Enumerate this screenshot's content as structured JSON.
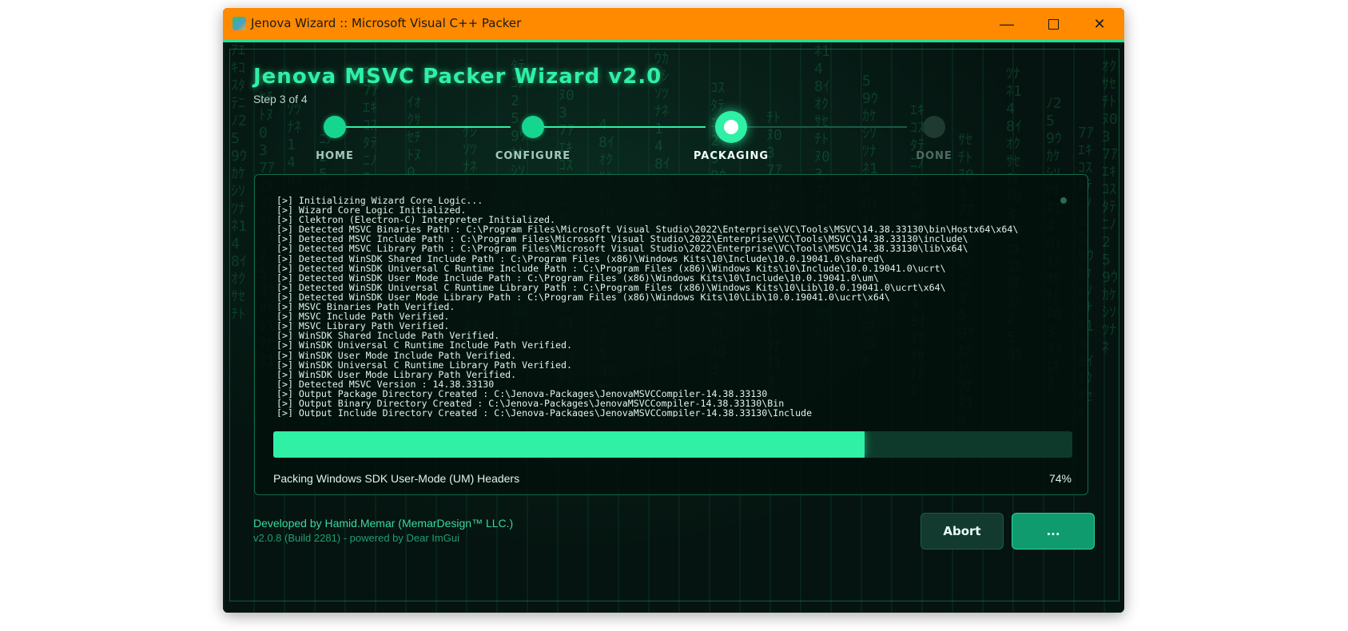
{
  "window": {
    "title": "Jenova Wizard :: Microsoft Visual C++ Packer",
    "title_bar_color": "#ff8a00",
    "controls": {
      "minimize_icon": "—",
      "close_icon": "✕"
    }
  },
  "wizard": {
    "title": "Jenova MSVC Packer Wizard v2.0",
    "step_text": "Step 3 of 4",
    "steps": [
      {
        "label": "HOME",
        "state": "done"
      },
      {
        "label": "CONFIGURE",
        "state": "done"
      },
      {
        "label": "PACKAGING",
        "state": "active"
      },
      {
        "label": "DONE",
        "state": "pending"
      }
    ],
    "accent_color": "#2ff0a5"
  },
  "log": {
    "lines": [
      "[>] Initializing Wizard Core Logic...",
      "[>] Wizard Core Logic Initialized.",
      "[>] Clektron (Electron-C) Interpreter Initialized.",
      "[>] Detected MSVC Binaries Path : C:\\Program Files\\Microsoft Visual Studio\\2022\\Enterprise\\VC\\Tools\\MSVC\\14.38.33130\\bin\\Hostx64\\x64\\",
      "[>] Detected MSVC Include Path : C:\\Program Files\\Microsoft Visual Studio\\2022\\Enterprise\\VC\\Tools\\MSVC\\14.38.33130\\include\\",
      "[>] Detected MSVC Library Path : C:\\Program Files\\Microsoft Visual Studio\\2022\\Enterprise\\VC\\Tools\\MSVC\\14.38.33130\\lib\\x64\\",
      "[>] Detected WinSDK Shared Include Path : C:\\Program Files (x86)\\Windows Kits\\10\\Include\\10.0.19041.0\\shared\\",
      "[>] Detected WinSDK Universal C Runtime Include Path : C:\\Program Files (x86)\\Windows Kits\\10\\Include\\10.0.19041.0\\ucrt\\",
      "[>] Detected WinSDK User Mode Include Path : C:\\Program Files (x86)\\Windows Kits\\10\\Include\\10.0.19041.0\\um\\",
      "[>] Detected WinSDK Universal C Runtime Library Path : C:\\Program Files (x86)\\Windows Kits\\10\\Lib\\10.0.19041.0\\ucrt\\x64\\",
      "[>] Detected WinSDK User Mode Library Path : C:\\Program Files (x86)\\Windows Kits\\10\\Lib\\10.0.19041.0\\ucrt\\x64\\",
      "[>] MSVC Binaries Path Verified.",
      "[>] MSVC Include Path Verified.",
      "[>] MSVC Library Path Verified.",
      "[>] WinSDK Shared Include Path Verified.",
      "[>] WinSDK Universal C Runtime Include Path Verified.",
      "[>] WinSDK User Mode Include Path Verified.",
      "[>] WinSDK Universal C Runtime Library Path Verified.",
      "[>] WinSDK User Mode Library Path Verified.",
      "[>] Detected MSVC Version : 14.38.33130",
      "[>] Output Package Directory Created : C:\\Jenova-Packages\\JenovaMSVCCompiler-14.38.33130",
      "[>] Output Binary Directory Created : C:\\Jenova-Packages\\JenovaMSVCCompiler-14.38.33130\\Bin",
      "[>] Output Include Directory Created : C:\\Jenova-Packages\\JenovaMSVCCompiler-14.38.33130\\Include"
    ]
  },
  "progress": {
    "fraction": 0.74,
    "percent_text": "74%",
    "label": "Packing Windows SDK User-Mode (UM) Headers"
  },
  "footer": {
    "developer": "Developed by Hamid.Memar (MemarDesign™ LLC.)",
    "version": "v2.0.8 (Build 2281) - powered by Dear ImGui"
  },
  "buttons": {
    "abort": "Abort",
    "next": "..."
  }
}
